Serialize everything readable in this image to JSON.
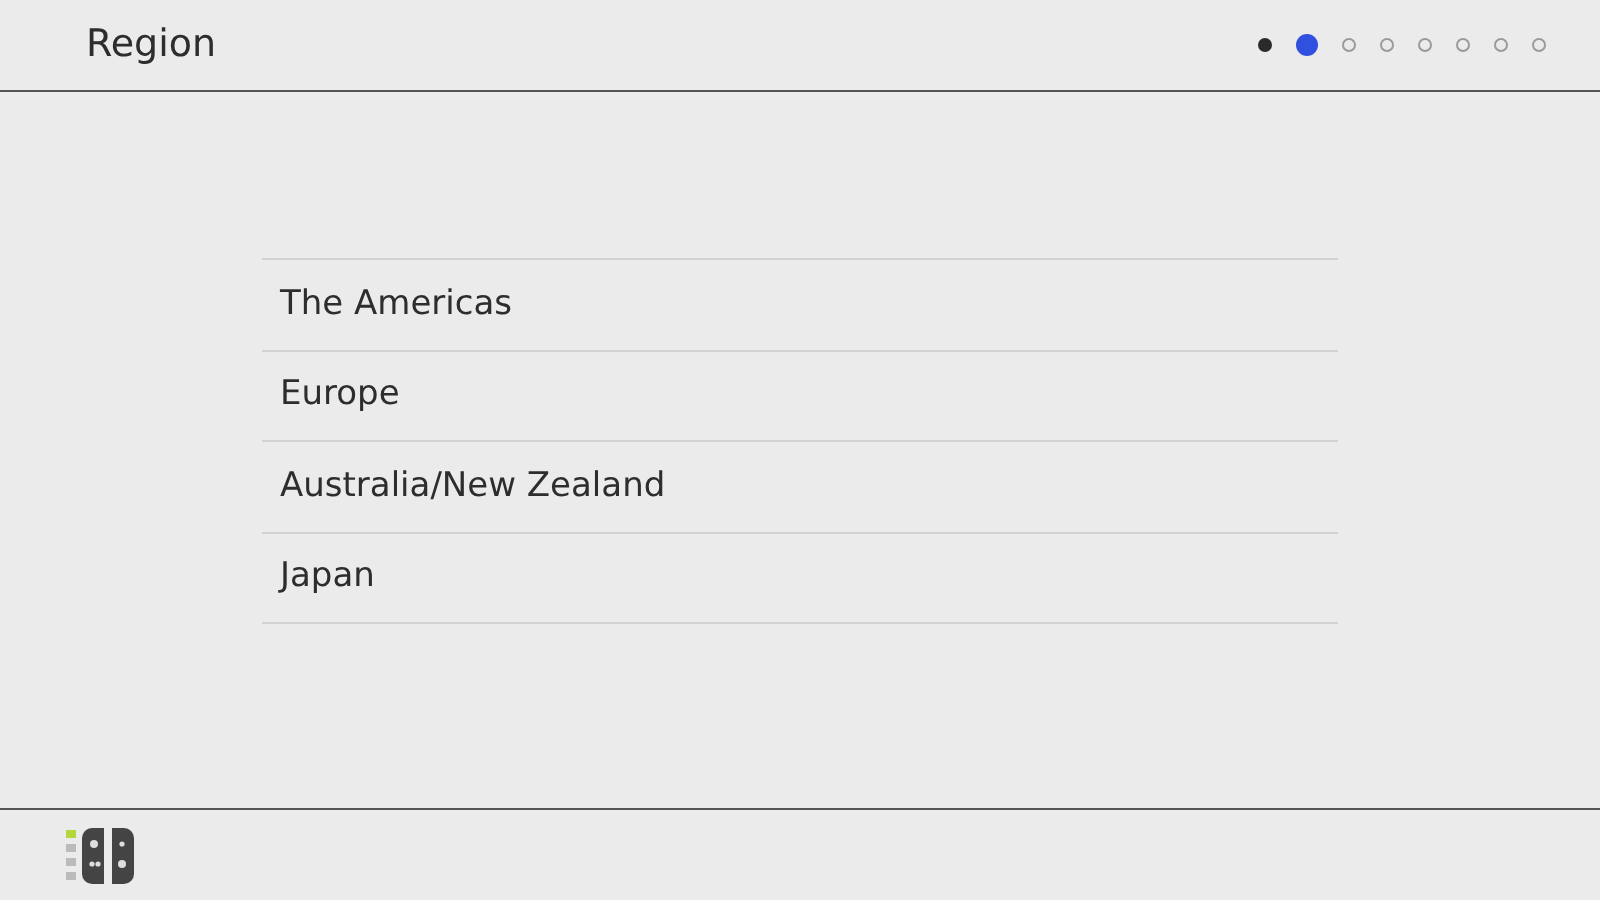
{
  "header": {
    "title": "Region"
  },
  "steps": [
    {
      "kind": "done"
    },
    {
      "kind": "current"
    },
    {
      "kind": "pending"
    },
    {
      "kind": "pending"
    },
    {
      "kind": "pending"
    },
    {
      "kind": "pending"
    },
    {
      "kind": "pending"
    },
    {
      "kind": "pending"
    }
  ],
  "regions": [
    {
      "label": "The Americas"
    },
    {
      "label": "Europe"
    },
    {
      "label": "Australia/New Zealand"
    },
    {
      "label": "Japan"
    }
  ]
}
